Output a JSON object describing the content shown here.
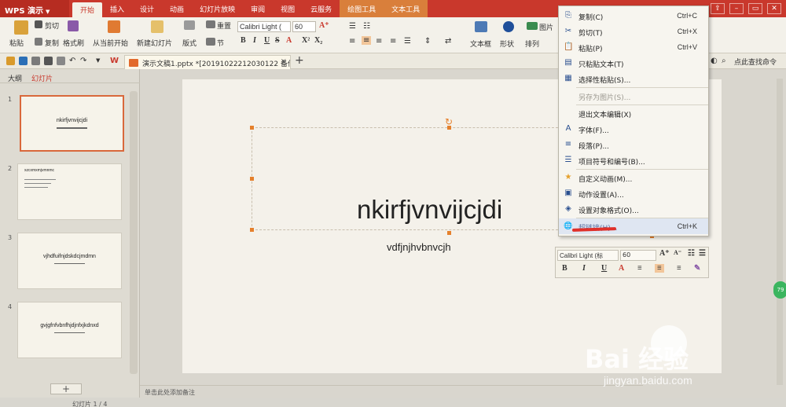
{
  "app": {
    "logo": "WPS 演示"
  },
  "menu_tabs": [
    "开始",
    "插入",
    "设计",
    "动画",
    "幻灯片放映",
    "审阅",
    "视图",
    "云服务",
    "绘图工具",
    "文本工具"
  ],
  "ribbon": {
    "paste": "粘贴",
    "cut": "剪切",
    "copy": "复制",
    "format_painter": "格式刷",
    "from_current": "从当前开始",
    "new_slide": "新建幻灯片",
    "layout": "版式",
    "reset": "重置",
    "section": "节",
    "font_name": "Calibri Light (",
    "font_size": "60",
    "textbox": "文本框",
    "shape": "形状",
    "arrange": "排列",
    "image": "图片"
  },
  "document": {
    "tab_title": "演示文稿1.pptx *[20191022212030122 备份]",
    "close": "×",
    "new_tab": "+",
    "find_command": "点此查找命令"
  },
  "left_panel": {
    "tab_outline": "大纲",
    "tab_slides": "幻灯片",
    "add_slide": "+",
    "status": "幻灯片 1 / 4",
    "slides": [
      {
        "num": "1",
        "title": "nkirfjvnvijcjdi"
      },
      {
        "num": "2",
        "title": "xzcxmxmjvmnmc"
      },
      {
        "num": "3",
        "title": "vjhdfuifnjdskdcjmdmn"
      },
      {
        "num": "4",
        "title": "gvjgfnfvbnfhjdjnfxjkdnxd"
      }
    ]
  },
  "slide": {
    "title": "nkirfjvnvijcjdi",
    "subtitle": "vdfjnjhvbnvcjh"
  },
  "notes_placeholder": "单击此处添加备注",
  "mini_toolbar": {
    "font": "Calibri Light (标",
    "size": "60"
  },
  "context_menu": [
    {
      "label": "复制(C)",
      "shortcut": "Ctrl+C",
      "icon": "copy-icon",
      "glyph": "⎘"
    },
    {
      "label": "剪切(T)",
      "shortcut": "Ctrl+X",
      "icon": "scissors-icon",
      "glyph": "✂"
    },
    {
      "label": "粘贴(P)",
      "shortcut": "Ctrl+V",
      "icon": "paste-icon",
      "glyph": "📋"
    },
    {
      "label": "只粘贴文本(T)",
      "shortcut": "",
      "icon": "paste-text-icon",
      "glyph": "▤"
    },
    {
      "label": "选择性粘贴(S)...",
      "shortcut": "",
      "icon": "paste-special-icon",
      "glyph": "▦"
    },
    {
      "label": "另存为图片(S)...",
      "shortcut": "",
      "icon": "",
      "glyph": ""
    },
    {
      "label": "退出文本编辑(X)",
      "shortcut": "",
      "icon": "",
      "glyph": ""
    },
    {
      "label": "字体(F)...",
      "shortcut": "",
      "icon": "font-icon",
      "glyph": "A"
    },
    {
      "label": "段落(P)...",
      "shortcut": "",
      "icon": "paragraph-icon",
      "glyph": "≡"
    },
    {
      "label": "项目符号和编号(B)...",
      "shortcut": "",
      "icon": "bullets-icon",
      "glyph": "☰"
    },
    {
      "label": "自定义动画(M)...",
      "shortcut": "",
      "icon": "animation-icon",
      "glyph": "★"
    },
    {
      "label": "动作设置(A)...",
      "shortcut": "",
      "icon": "action-icon",
      "glyph": "▣"
    },
    {
      "label": "设置对象格式(O)...",
      "shortcut": "",
      "icon": "format-object-icon",
      "glyph": "◈"
    },
    {
      "label": "超链接(H)...",
      "shortcut": "Ctrl+K",
      "icon": "hyperlink-icon",
      "glyph": "🌐"
    }
  ],
  "badge": "79",
  "watermark": {
    "text": "Bai  经验",
    "url": "jingyan.baidu.com"
  },
  "colors": {
    "title_bar": "#c9382c",
    "ribbon": "#f3f1ea",
    "accent": "#e5802c",
    "highlight": "#dfe6f2",
    "annotation_red": "#e0302a"
  }
}
